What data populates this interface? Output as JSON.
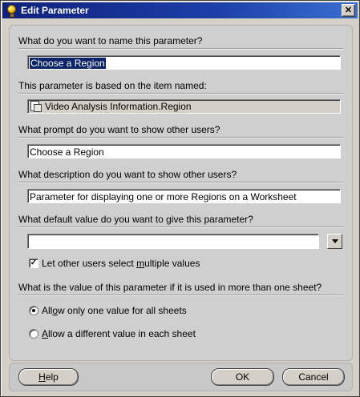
{
  "window": {
    "title": "Edit Parameter",
    "close_label": "✕"
  },
  "q1": {
    "label": "What do you want to name this parameter?",
    "value": "Choose a Region"
  },
  "q2": {
    "label": "This parameter is based on the item named:",
    "value": "Video Analysis Information.Region"
  },
  "q3": {
    "label": "What prompt do you want to show other users?",
    "value": "Choose a Region"
  },
  "q4": {
    "label": "What description do you want to show other users?",
    "value": "Parameter for displaying one or more Regions on a Worksheet"
  },
  "q5": {
    "label": "What default value do you want to give this parameter?",
    "value": ""
  },
  "multi": {
    "label_pre": "Let other users select ",
    "label_u": "m",
    "label_post": "ultiple values",
    "checked": "✓"
  },
  "q6": {
    "label": "What is the value of this parameter if it is used in more than one sheet?"
  },
  "opt1": {
    "pre": "All",
    "u": "o",
    "post": "w only one value for all sheets",
    "selected": true
  },
  "opt2": {
    "pre": "",
    "u": "A",
    "post": "llow a different value in each sheet",
    "selected": false
  },
  "buttons": {
    "help_u": "H",
    "help_rest": "elp",
    "ok": "OK",
    "cancel": "Cancel"
  }
}
